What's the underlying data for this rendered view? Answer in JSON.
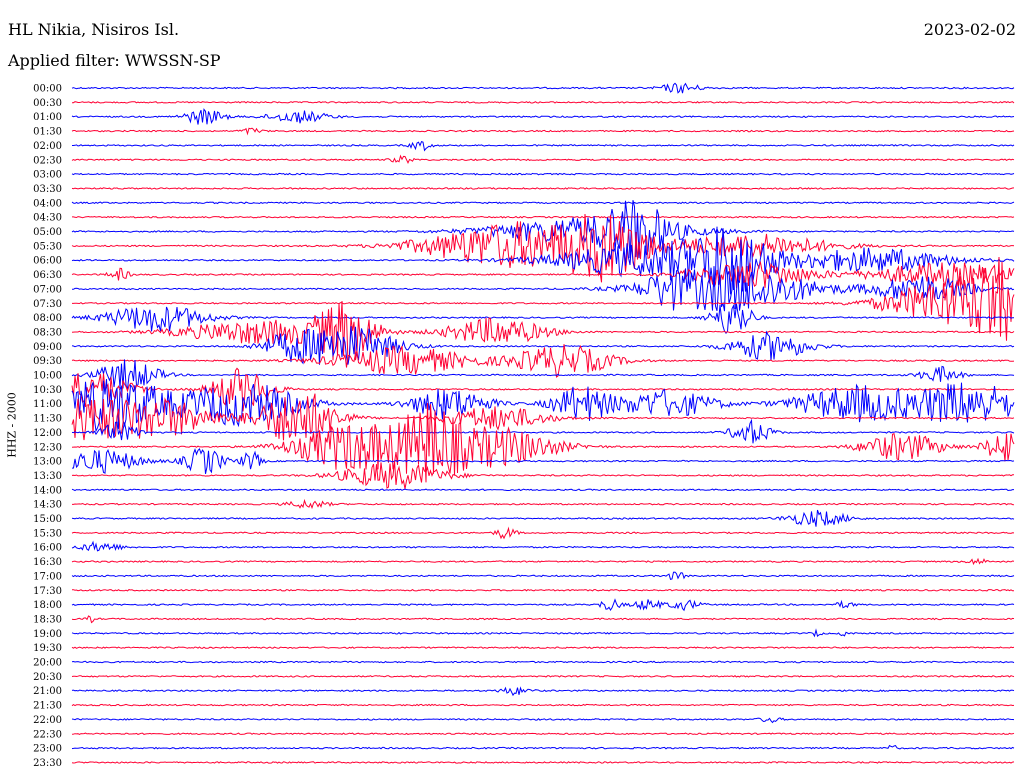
{
  "header": {
    "station": "HL Nikia, Nisiros Isl.",
    "date": "2023-02-02",
    "filter": "Applied filter: WWSSN-SP",
    "channel": "HHZ - 2000"
  },
  "colors": {
    "even_row": "#0000ff",
    "odd_row": "#ff0033",
    "text": "#000000"
  },
  "chart_data": {
    "type": "line",
    "subtype": "helicorder",
    "rows": [
      {
        "label": "00:00",
        "color": "blue",
        "bursts": [
          [
            0.645,
            0.02,
            5
          ]
        ]
      },
      {
        "label": "00:30",
        "color": "red",
        "bursts": []
      },
      {
        "label": "01:00",
        "color": "blue",
        "bursts": [
          [
            0.14,
            0.02,
            8
          ],
          [
            0.24,
            0.03,
            6
          ]
        ]
      },
      {
        "label": "01:30",
        "color": "red",
        "bursts": [
          [
            0.19,
            0.01,
            3
          ]
        ]
      },
      {
        "label": "02:00",
        "color": "blue",
        "bursts": [
          [
            0.37,
            0.01,
            5
          ]
        ]
      },
      {
        "label": "02:30",
        "color": "red",
        "bursts": [
          [
            0.35,
            0.01,
            4
          ]
        ]
      },
      {
        "label": "03:00",
        "color": "blue",
        "bursts": []
      },
      {
        "label": "03:30",
        "color": "red",
        "bursts": []
      },
      {
        "label": "04:00",
        "color": "blue",
        "bursts": []
      },
      {
        "label": "04:30",
        "color": "red",
        "bursts": []
      },
      {
        "label": "05:00",
        "color": "blue",
        "bursts": [
          [
            0.55,
            0.1,
            14
          ],
          [
            0.6,
            0.03,
            22
          ]
        ]
      },
      {
        "label": "05:30",
        "color": "red",
        "bursts": [
          [
            0.47,
            0.09,
            24
          ],
          [
            0.57,
            0.04,
            30
          ],
          [
            0.72,
            0.08,
            12
          ]
        ]
      },
      {
        "label": "06:00",
        "color": "blue",
        "bursts": [
          [
            0.62,
            0.1,
            18
          ],
          [
            0.7,
            0.04,
            28
          ],
          [
            0.85,
            0.08,
            12
          ]
        ]
      },
      {
        "label": "06:30",
        "color": "red",
        "bursts": [
          [
            0.05,
            0.01,
            6
          ],
          [
            0.72,
            0.06,
            14
          ],
          [
            0.93,
            0.08,
            12
          ]
        ]
      },
      {
        "label": "07:00",
        "color": "blue",
        "bursts": [
          [
            0.63,
            0.02,
            10
          ],
          [
            0.7,
            0.08,
            24
          ],
          [
            0.9,
            0.05,
            14
          ]
        ]
      },
      {
        "label": "07:30",
        "color": "red",
        "bursts": [
          [
            0.94,
            0.07,
            26
          ],
          [
            0.98,
            0.02,
            30
          ]
        ]
      },
      {
        "label": "08:00",
        "color": "blue",
        "bursts": [
          [
            0.09,
            0.05,
            14
          ],
          [
            0.7,
            0.02,
            20
          ]
        ]
      },
      {
        "label": "08:30",
        "color": "red",
        "bursts": [
          [
            0.2,
            0.08,
            12
          ],
          [
            0.29,
            0.03,
            30
          ],
          [
            0.45,
            0.05,
            14
          ]
        ]
      },
      {
        "label": "09:00",
        "color": "blue",
        "bursts": [
          [
            0.23,
            0.03,
            10
          ],
          [
            0.29,
            0.05,
            22
          ],
          [
            0.74,
            0.04,
            14
          ]
        ]
      },
      {
        "label": "09:30",
        "color": "red",
        "bursts": [
          [
            0.35,
            0.07,
            14
          ],
          [
            0.52,
            0.05,
            16
          ]
        ]
      },
      {
        "label": "10:00",
        "color": "blue",
        "bursts": [
          [
            0.92,
            0.02,
            8
          ],
          [
            0.06,
            0.03,
            16
          ]
        ]
      },
      {
        "label": "10:30",
        "color": "red",
        "bursts": [
          [
            0.02,
            0.04,
            18
          ],
          [
            0.18,
            0.03,
            22
          ]
        ]
      },
      {
        "label": "11:00",
        "color": "blue",
        "bursts": [
          [
            0.04,
            0.06,
            28
          ],
          [
            0.18,
            0.06,
            22
          ],
          [
            0.4,
            0.04,
            16
          ],
          [
            0.54,
            0.03,
            18
          ],
          [
            0.63,
            0.05,
            14
          ],
          [
            0.83,
            0.06,
            18
          ],
          [
            0.95,
            0.06,
            22
          ]
        ]
      },
      {
        "label": "11:30",
        "color": "red",
        "bursts": [
          [
            0.01,
            0.06,
            22
          ],
          [
            0.1,
            0.05,
            18
          ],
          [
            0.24,
            0.04,
            30
          ],
          [
            0.45,
            0.05,
            12
          ]
        ]
      },
      {
        "label": "12:00",
        "color": "blue",
        "bursts": [
          [
            0.05,
            0.02,
            10
          ],
          [
            0.72,
            0.02,
            12
          ]
        ]
      },
      {
        "label": "12:30",
        "color": "red",
        "bursts": [
          [
            0.3,
            0.06,
            26
          ],
          [
            0.38,
            0.03,
            36
          ],
          [
            0.45,
            0.06,
            20
          ],
          [
            0.88,
            0.04,
            14
          ],
          [
            0.99,
            0.02,
            18
          ]
        ]
      },
      {
        "label": "13:00",
        "color": "blue",
        "bursts": [
          [
            0.03,
            0.04,
            12
          ],
          [
            0.14,
            0.02,
            14
          ],
          [
            0.19,
            0.01,
            10
          ]
        ]
      },
      {
        "label": "13:30",
        "color": "red",
        "bursts": [
          [
            0.34,
            0.05,
            14
          ]
        ]
      },
      {
        "label": "14:00",
        "color": "blue",
        "bursts": []
      },
      {
        "label": "14:30",
        "color": "red",
        "bursts": [
          [
            0.25,
            0.02,
            4
          ]
        ]
      },
      {
        "label": "15:00",
        "color": "blue",
        "bursts": [
          [
            0.79,
            0.03,
            8
          ]
        ]
      },
      {
        "label": "15:30",
        "color": "red",
        "bursts": [
          [
            0.46,
            0.01,
            6
          ]
        ]
      },
      {
        "label": "16:00",
        "color": "blue",
        "bursts": [
          [
            0.03,
            0.02,
            5
          ]
        ]
      },
      {
        "label": "16:30",
        "color": "red",
        "bursts": [
          [
            0.96,
            0.01,
            3
          ]
        ]
      },
      {
        "label": "17:00",
        "color": "blue",
        "bursts": [
          [
            0.64,
            0.01,
            4
          ]
        ]
      },
      {
        "label": "17:30",
        "color": "red",
        "bursts": []
      },
      {
        "label": "18:00",
        "color": "blue",
        "bursts": [
          [
            0.57,
            0.01,
            6
          ],
          [
            0.61,
            0.015,
            5
          ],
          [
            0.65,
            0.015,
            5
          ],
          [
            0.82,
            0.01,
            3
          ]
        ]
      },
      {
        "label": "18:30",
        "color": "red",
        "bursts": [
          [
            0.02,
            0.005,
            3
          ]
        ]
      },
      {
        "label": "19:00",
        "color": "blue",
        "bursts": [
          [
            0.79,
            0.005,
            3
          ],
          [
            0.82,
            0.005,
            3
          ]
        ]
      },
      {
        "label": "19:30",
        "color": "red",
        "bursts": []
      },
      {
        "label": "20:00",
        "color": "blue",
        "bursts": []
      },
      {
        "label": "20:30",
        "color": "red",
        "bursts": []
      },
      {
        "label": "21:00",
        "color": "blue",
        "bursts": [
          [
            0.47,
            0.015,
            4
          ]
        ]
      },
      {
        "label": "21:30",
        "color": "red",
        "bursts": []
      },
      {
        "label": "22:00",
        "color": "blue",
        "bursts": [
          [
            0.74,
            0.01,
            3
          ]
        ]
      },
      {
        "label": "22:30",
        "color": "red",
        "bursts": []
      },
      {
        "label": "23:00",
        "color": "blue",
        "bursts": [
          [
            0.87,
            0.005,
            3
          ]
        ]
      },
      {
        "label": "23:30",
        "color": "red",
        "bursts": []
      }
    ]
  }
}
